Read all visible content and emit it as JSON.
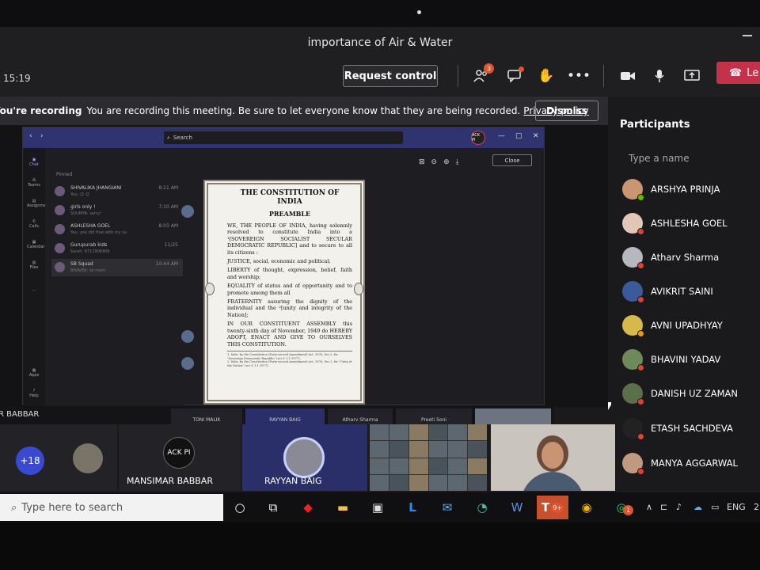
{
  "window": {
    "title": "importance of Air & Water"
  },
  "meeting": {
    "clock": "15:19",
    "request_control": "Request control",
    "people_badge": "3",
    "leave_label": "Le"
  },
  "recording": {
    "title": "You're recording",
    "message": "You are recording this meeting. Be sure to let everyone know that they are being recorded.",
    "link": "Privacy policy",
    "dismiss": "Dismiss"
  },
  "shared": {
    "search_label": "Search",
    "avatar_text": "ACK PI",
    "close_label": "Close",
    "chat_header": "Pinned",
    "chats": [
      {
        "name": "SHIVALIKA JHANGIANI",
        "preview": "You: ☺ ☺",
        "time": "8:21 AM"
      },
      {
        "name": "girls only !",
        "preview": "SOUMYA: sorry!",
        "time": "7:10 AM"
      },
      {
        "name": "ASHLESHA GOEL",
        "preview": "You: you did that with my so",
        "time": "8:03 AM"
      },
      {
        "name": "Gurupurab kids",
        "preview": "Sarah: 9711906806",
        "time": "11/25"
      },
      {
        "name": "SB Squad",
        "preview": "BHAVINI: ok mam",
        "time": "10:44 AM"
      }
    ],
    "rail": [
      "Chat",
      "Teams",
      "Assignments",
      "Calls",
      "Calendar",
      "Files",
      "...",
      "Apps",
      "Help"
    ],
    "doc": {
      "title": "THE CONSTITUTION OF INDIA",
      "subtitle": "PREAMBLE",
      "p1": "WE, THE PEOPLE OF INDIA, having solemnly resolved to constitute India into a ¹[SOVEREIGN SOCIALIST SECULAR DEMOCRATIC REPUBLIC] and to secure to all its citizens :",
      "p2": "JUSTICE, social, economic and political;",
      "p3": "LIBERTY of thought, expression, belief, faith and worship;",
      "p4": "EQUALITY of status and of opportunity and to promote among them all",
      "p5": "FRATERNITY assuring the dignity of the individual and the ²[unity and integrity of the Nation];",
      "p6": "IN OUR CONSTITUENT ASSEMBLY this twenty-sixth day of November, 1949 do HEREBY ADOPT, ENACT AND GIVE TO OURSELVES THIS CONSTITUTION.",
      "foot1": "1. Subs. by the Constitution (Forty-second Amendment) Act, 1976, Sec.2, for \"Sovereign Democratic Republic\" (w.e.f. 3.1.1977).",
      "foot2": "2. Subs. by the Constitution (Forty-second Amendment) Act, 1976, Sec.2, for \"Unity of the Nation\" (w.e.f. 3.1.1977)."
    }
  },
  "film_strip": {
    "edge_label": "R BABBAR",
    "tiles": [
      "TONI MALIK",
      "RAYYAN BAIG",
      "Atharv Sharma",
      "Preeti Soni"
    ]
  },
  "participants": {
    "title": "Participants",
    "search_placeholder": "Type a name",
    "list": [
      "ARSHYA PRINJA",
      "ASHLESHA GOEL",
      "Atharv Sharma",
      "AVIKRIT SAINI",
      "AVNI UPADHYAY",
      "BHAVINI YADAV",
      "DANISH UZ ZAMAN",
      "ETASH SACHDEVA",
      "MANYA AGGARWAL"
    ]
  },
  "gallery": {
    "more_count": "+18",
    "logo_text": "ACK PI",
    "tile1": "MANSIMAR BABBAR",
    "tile2": "RAYYAN BAIG"
  },
  "taskbar": {
    "search_placeholder": "Type here to search",
    "teams_badge": "9+",
    "whatsapp_badge": "1",
    "lang": "ENG",
    "clock_edge": "2"
  },
  "colors": {
    "leave": "#c4314b",
    "teams_purple": "#2f3470",
    "accent": "#3a4ad0"
  }
}
